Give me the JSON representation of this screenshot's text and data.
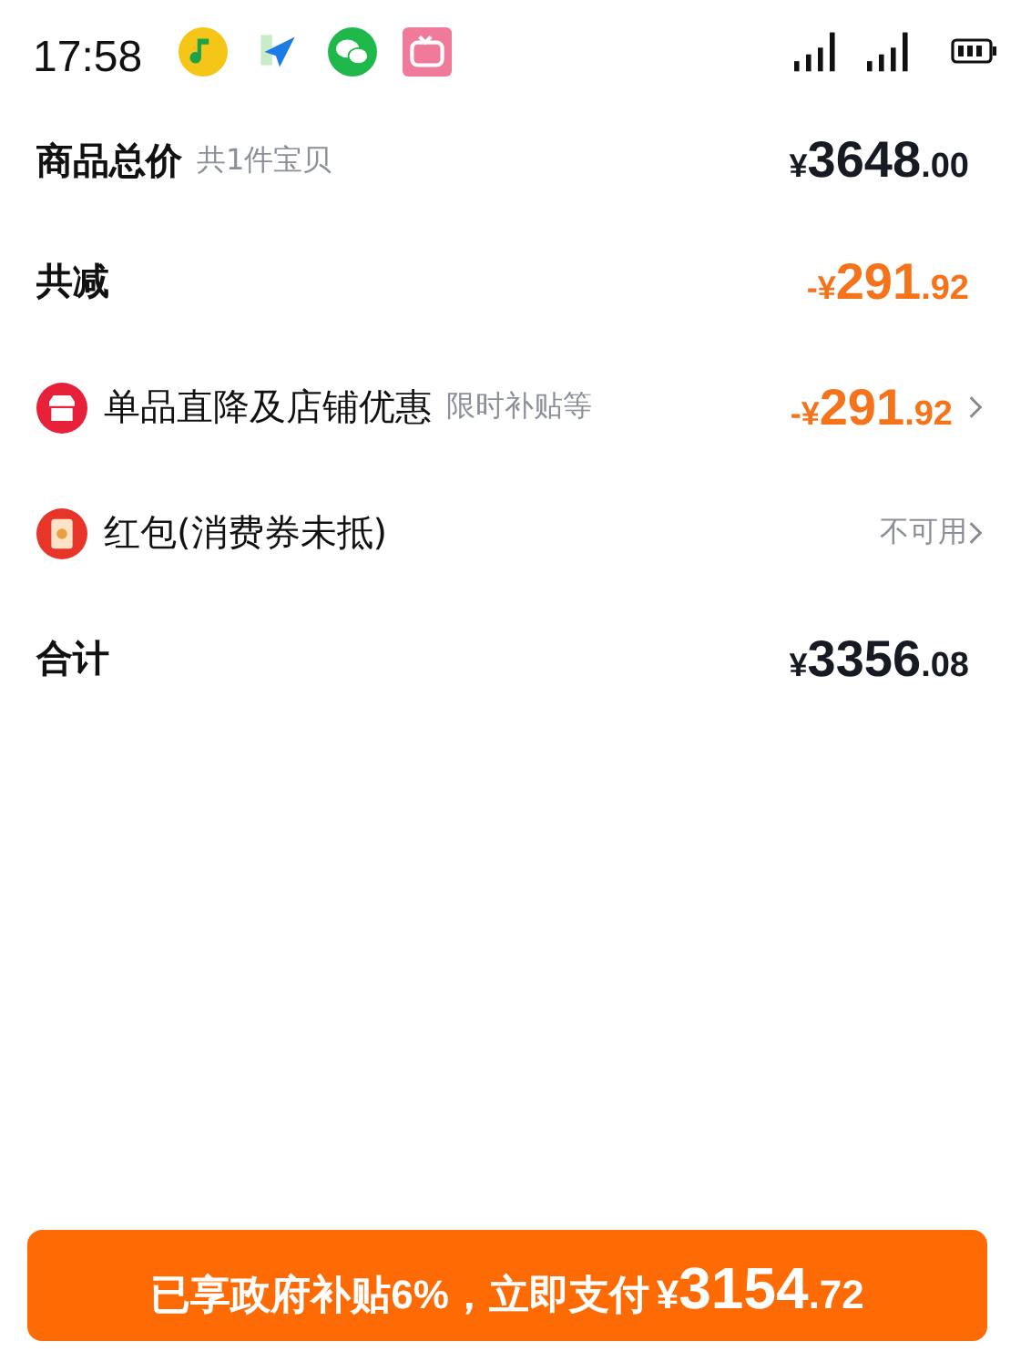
{
  "status_bar": {
    "time": "17:58"
  },
  "rows": [
    {
      "kind": "plain",
      "label": "商品总价",
      "note": "共1件宝贝",
      "amount": {
        "currency": "¥",
        "integer": "3648",
        "decimal": ".00"
      }
    },
    {
      "kind": "discount",
      "label": "共减",
      "amount": {
        "sign": "-",
        "currency": "¥",
        "integer": "291",
        "decimal": ".92"
      }
    },
    {
      "kind": "promo",
      "label": "单品直降及店铺优惠",
      "note": "限时补贴等",
      "amount": {
        "sign": "-",
        "currency": "¥",
        "integer": "291",
        "decimal": ".92"
      }
    },
    {
      "kind": "packet",
      "label": "红包(消费券未抵)",
      "value": "不可用"
    },
    {
      "kind": "plain",
      "label": "合计",
      "amount": {
        "currency": "¥",
        "integer": "3356",
        "decimal": ".08"
      }
    }
  ],
  "pay_button": {
    "text": "已享政府补贴6%，立即支付",
    "currency": "¥",
    "integer": "3154",
    "decimal": ".72"
  }
}
